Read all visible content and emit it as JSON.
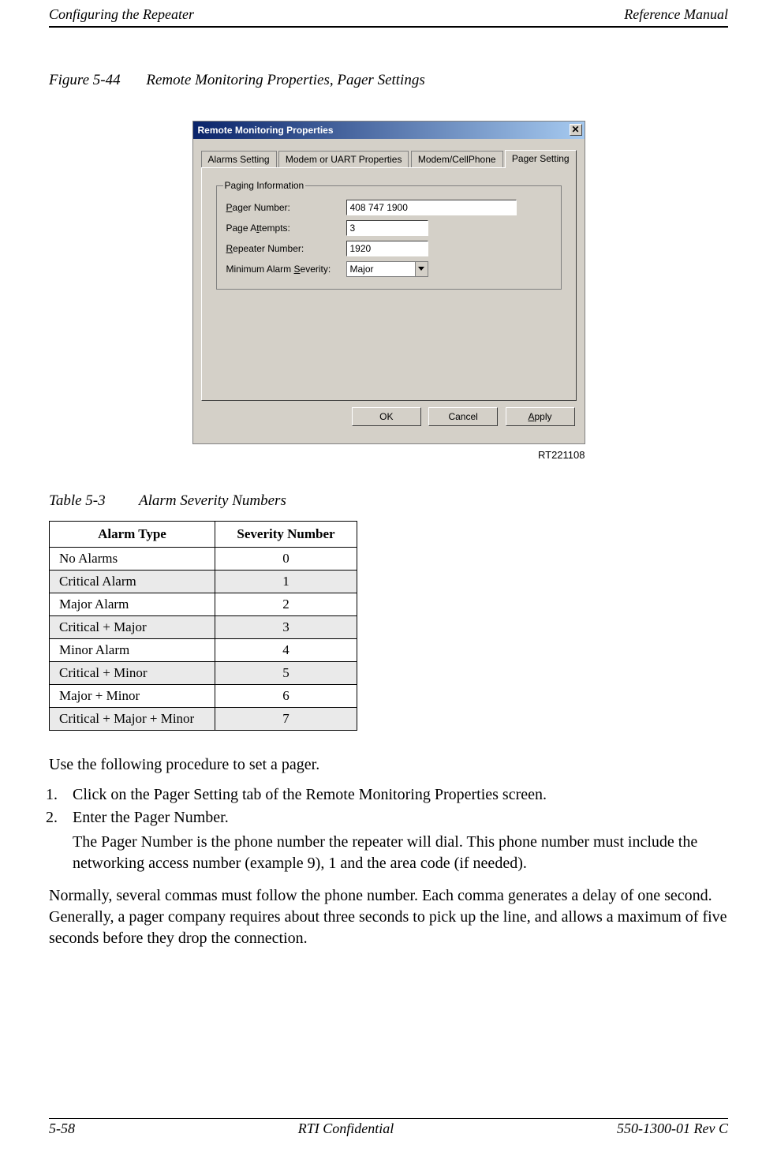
{
  "header": {
    "left": "Configuring the Repeater",
    "right": "Reference Manual"
  },
  "figure": {
    "label": "Figure 5-44",
    "title": "Remote Monitoring Properties, Pager Settings"
  },
  "dialog": {
    "title": "Remote Monitoring Properties",
    "close_glyph": "✕",
    "tabs": [
      "Alarms Setting",
      "Modem or UART Properties",
      "Modem/CellPhone",
      "Pager Setting"
    ],
    "group_legend": "Paging Information",
    "fields": {
      "pager_number": {
        "label_pre": "",
        "label_mn": "P",
        "label_post": "ager Number:",
        "value": "408 747 1900"
      },
      "page_attempts": {
        "label_pre": "Page A",
        "label_mn": "t",
        "label_post": "tempts:",
        "value": "3"
      },
      "repeater_number": {
        "label_pre": "",
        "label_mn": "R",
        "label_post": "epeater Number:",
        "value": "1920"
      },
      "min_severity": {
        "label_pre": "Minimum Alarm ",
        "label_mn": "S",
        "label_post": "everity:",
        "value": "Major"
      }
    },
    "buttons": {
      "ok": "OK",
      "cancel": "Cancel",
      "apply_mn": "A",
      "apply_post": "pply"
    },
    "image_id": "RT221108"
  },
  "table": {
    "label": "Table 5-3",
    "title": "Alarm Severity Numbers",
    "head": [
      "Alarm Type",
      "Severity Number"
    ],
    "rows": [
      {
        "type": "No Alarms",
        "num": "0"
      },
      {
        "type": "Critical Alarm",
        "num": "1"
      },
      {
        "type": "Major Alarm",
        "num": "2"
      },
      {
        "type": "Critical + Major",
        "num": "3"
      },
      {
        "type": "Minor Alarm",
        "num": "4"
      },
      {
        "type": "Critical + Minor",
        "num": "5"
      },
      {
        "type": "Major + Minor",
        "num": "6"
      },
      {
        "type": "Critical + Major + Minor",
        "num": "7"
      }
    ]
  },
  "body": {
    "intro": "Use the following procedure to set a pager.",
    "steps": [
      {
        "text": "Click on the Pager Setting tab of the Remote Monitoring Properties screen."
      },
      {
        "text": "Enter the Pager Number.",
        "sub": "The Pager Number is the phone number the repeater will dial. This phone number must include the networking access number (example 9), 1 and the area code (if needed)."
      }
    ],
    "after": "Normally, several commas must follow the phone number. Each comma generates a delay of one second. Generally, a pager company requires about three seconds to pick up the line, and allows a maximum of five seconds before they drop the connection."
  },
  "footer": {
    "left": "5-58",
    "center": "RTI Confidential",
    "right": "550-1300-01 Rev C"
  }
}
